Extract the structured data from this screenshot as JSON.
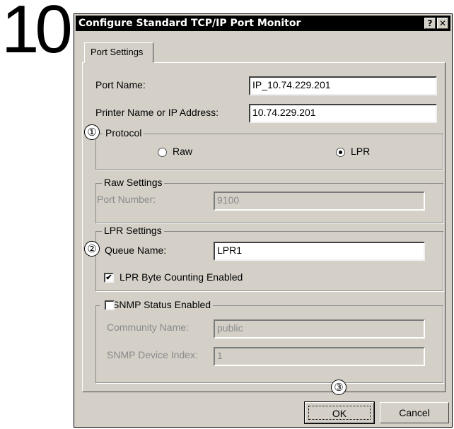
{
  "step_number": "10",
  "dialog": {
    "title": "Configure Standard TCP/IP Port Monitor",
    "help_button": "?",
    "close_button": "✕",
    "tab": "Port Settings",
    "port_name": {
      "label": "Port Name:",
      "value": "IP_10.74.229.201"
    },
    "printer_address": {
      "label": "Printer Name or IP Address:",
      "value": "10.74.229.201"
    },
    "protocol": {
      "title": "Protocol",
      "marker": "①",
      "options": [
        {
          "label": "Raw",
          "checked": false
        },
        {
          "label": "LPR",
          "checked": true
        }
      ]
    },
    "raw_settings": {
      "title": "Raw Settings",
      "port_number_label": "Port Number:",
      "port_number_value": "9100"
    },
    "lpr_settings": {
      "title": "LPR Settings",
      "marker": "②",
      "queue_label": "Queue Name:",
      "queue_value": "LPR1",
      "byte_counting_label": "LPR Byte Counting Enabled",
      "byte_counting_checked": true
    },
    "snmp": {
      "title": "SNMP Status Enabled",
      "checked": false,
      "community_label": "Community Name:",
      "community_value": "public",
      "device_index_label": "SNMP Device Index:",
      "device_index_value": "1"
    },
    "ok_marker": "③",
    "ok_button": "OK",
    "cancel_button": "Cancel"
  }
}
